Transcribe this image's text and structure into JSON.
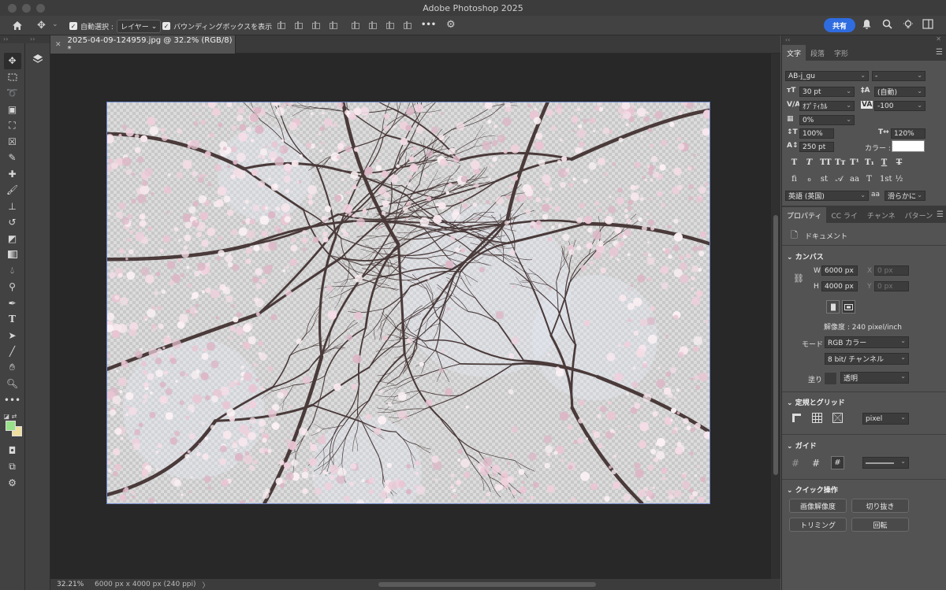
{
  "window": {
    "title": "Adobe Photoshop 2025"
  },
  "optionsbar": {
    "auto_select_label": "自動選択 :",
    "auto_select_value": "レイヤー",
    "bbox_label": "バウンディングボックスを表示",
    "share_label": "共有",
    "more_label": "•••"
  },
  "tools": [
    "move-tool",
    "marquee-tool",
    "lasso-tool",
    "object-selection-tool",
    "crop-tool",
    "frame-tool",
    "eyedropper-tool",
    "spot-healing-tool",
    "brush-tool",
    "clone-stamp-tool",
    "history-brush-tool",
    "eraser-tool",
    "gradient-tool",
    "blur-tool",
    "dodge-tool",
    "pen-tool",
    "type-tool",
    "path-selection-tool",
    "line-tool",
    "hand-tool",
    "zoom-tool",
    "more-tools"
  ],
  "colors": {
    "foreground": "#98e08a",
    "background": "#f0e0a0",
    "accent": "#2f6ce0"
  },
  "document": {
    "tab_title": "2025-04-09-124959.jpg @ 32.2% (RGB/8) *",
    "zoom": "32.21%",
    "info": "6000 px x 4000 px (240 ppi)",
    "info_arrow": "〉"
  },
  "character_panel": {
    "tabs": [
      "文字",
      "段落",
      "字形"
    ],
    "font_family": "AB-j_gu",
    "font_style": "-",
    "font_size": "30 pt",
    "leading": "(自動)",
    "kerning": "ｵﾌﾟﾃｨｶﾙ",
    "tracking": "-100",
    "tsume": "0%",
    "vscale": "100%",
    "hscale": "120%",
    "baseline": "250 pt",
    "color_label": "カラー :",
    "language": "英語 (英国)",
    "antialias": "滑らかに",
    "aa_label": "aa"
  },
  "properties_panel": {
    "tabs": [
      "プロパティ",
      "CC ライ",
      "チャンネ",
      "パターン"
    ],
    "doc_label": "ドキュメント",
    "canvas_section": "カンバス",
    "w_label": "W",
    "w_value": "6000 px",
    "h_label": "H",
    "h_value": "4000 px",
    "x_label": "X",
    "x_placeholder": "0 px",
    "y_label": "Y",
    "y_placeholder": "0 px",
    "resolution": "解像度 : 240 pixel/inch",
    "mode_label": "モード",
    "mode_value": "RGB カラー",
    "bitdepth": "8 bit/ チャンネル",
    "fill_label": "塗り",
    "fill_value": "透明",
    "rulers_section": "定規とグリッド",
    "rulers_unit": "pixel",
    "guides_section": "ガイド",
    "quick_section": "クイック操作",
    "quick_buttons": [
      "画像解像度",
      "切り抜き",
      "トリミング",
      "回転"
    ]
  }
}
